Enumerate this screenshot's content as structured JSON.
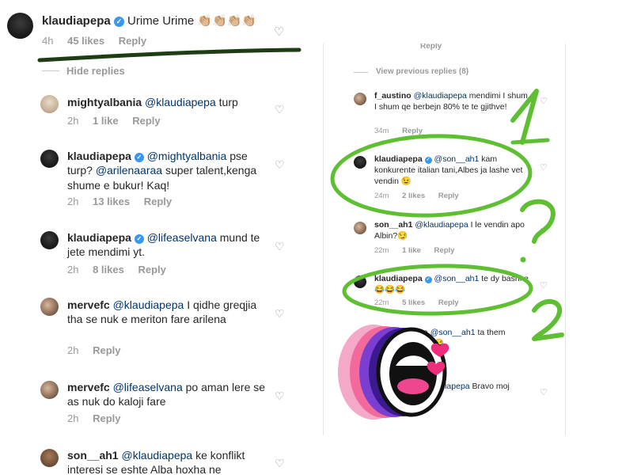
{
  "left": {
    "top_comment": {
      "user": "klaudiapepa",
      "text": "Urime Urime",
      "emoji": "👏🏼👏🏼👏🏼👏🏼",
      "time": "4h",
      "likes": "45 likes",
      "reply": "Reply"
    },
    "hide_replies": "Hide replies",
    "replies": [
      {
        "user": "mightyalbania",
        "mention": "@klaudiapepa",
        "text": " turp",
        "time": "2h",
        "likes": "1 like",
        "reply": "Reply"
      },
      {
        "user": "klaudiapepa",
        "mention": "@mightyalbania",
        "text": " pse turp? ",
        "mention2": "@arilenaaraa",
        "text2": " super talent,kenga shume e bukur! Kaq!",
        "time": "2h",
        "likes": "13 likes",
        "reply": "Reply"
      },
      {
        "user": "klaudiapepa",
        "mention": "@lifeaselvana",
        "text": " mund te jete mendimi yt.",
        "time": "2h",
        "likes": "8 likes",
        "reply": "Reply"
      },
      {
        "user": "mervefc",
        "mention": "@klaudiapepa",
        "text": " I qidhe greqjia tha se nuk e meriton fare arilena",
        "time": "2h",
        "reply": "Reply"
      },
      {
        "user": "mervefc",
        "mention": "@lifeaselvana",
        "text": " po aman lere se as nuk do kaloji fare",
        "time": "2h",
        "reply": "Reply"
      },
      {
        "user": "son__ah1",
        "mention": "@klaudiapepa",
        "text": " ke konflikt interesi se eshte Alba hoxha ne"
      }
    ]
  },
  "right": {
    "top_reply": "Reply",
    "view_previous": "View previous replies (8)",
    "comments": [
      {
        "user": "f_austino",
        "mention": "@klaudiapepa",
        "text": " mendimi I shum I shum qe berbejn 80% te te gjithve!",
        "time": "34m",
        "reply": "Reply"
      },
      {
        "user": "klaudiapepa",
        "mention": "@son__ah1",
        "text": " kam konkurente italian tani,Albes ja lashe vet vendin",
        "emoji": "😉",
        "time": "24m",
        "likes": "2 likes",
        "reply": "Reply"
      },
      {
        "user": "son__ah1",
        "mention": "@klaudiapepa",
        "text": " I le vendin apo Albin?",
        "emoji": "😏",
        "time": "22m",
        "likes": "1 like",
        "reply": "Reply"
      },
      {
        "user": "klaudiapepa",
        "mention": "@son__ah1",
        "text": " te dy bashke",
        "emoji": "😂😂😂",
        "time": "22m",
        "likes": "5 likes",
        "reply": "Reply"
      },
      {
        "mention": "a @son__ah1",
        "text": " ta them",
        "emoji": "😂😂"
      },
      {
        "user": "klaudiapepa",
        "text": " Bravo moj"
      }
    ]
  },
  "annotations": {
    "number1": "1",
    "number2": "2",
    "qmark": "?"
  },
  "colors": {
    "accent_green": "#5fbf33",
    "marker_dark": "#1e3d14",
    "verified_blue": "#3897f0",
    "mention": "#003569",
    "meta": "#999999"
  },
  "icons": {
    "heart": "heart-outline-icon",
    "verified": "verified-badge-icon",
    "sticker": "open-mouth-sticker-icon",
    "love": "pink-heart-icon"
  }
}
